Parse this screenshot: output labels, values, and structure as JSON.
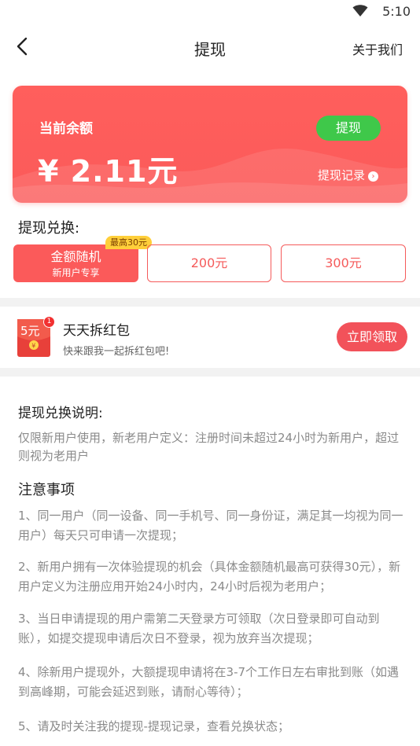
{
  "status_bar": {
    "time": "5:10"
  },
  "nav": {
    "title": "提现",
    "about": "关于我们"
  },
  "balance": {
    "label": "当前余额",
    "amount": "¥ 2.11元",
    "withdraw_button": "提现",
    "record_link": "提现记录"
  },
  "exchange": {
    "title": "提现兑换:",
    "badge": "最高30元",
    "options": [
      {
        "main": "金额随机",
        "sub": "新用户专享",
        "selected": true
      },
      {
        "main": "200元"
      },
      {
        "main": "300元"
      }
    ]
  },
  "redpack": {
    "icon_label": "5元",
    "badge_count": "1",
    "title": "天天拆红包",
    "subtitle": "快来跟我一起拆红包吧!",
    "claim_button": "立即领取"
  },
  "description": {
    "title": "提现兑换说明:",
    "body": "仅限新用户使用，新老用户定义：注册时间未超过24小时为新用户，超过则视为老用户",
    "notice_title": "注意事项",
    "notices": [
      "1、同一用户（同一设备、同一手机号、同一身份证，满足其一均视为同一用户）每天只可申请一次提现；",
      "2、新用户拥有一次体验提现的机会（具体金额随机最高可获得30元），新用户定义为注册应用开始24小时内，24小时后视为老用户；",
      "3、当日申请提现的用户需第二天登录方可领取（次日登录即可自动到账），如提交提现申请后次日不登录，视为放弃当次提现；",
      "4、除新用户提现外，大额提现申请将在3-7个工作日左右审批到账（如遇到高峰期，可能会延迟到账，请耐心等待）；",
      "5、请及时关注我的提现-提现记录，查看兑换状态；"
    ]
  },
  "colors": {
    "accent": "#fb5a5a",
    "green": "#3fc84a",
    "badge": "#ffcf3a"
  }
}
